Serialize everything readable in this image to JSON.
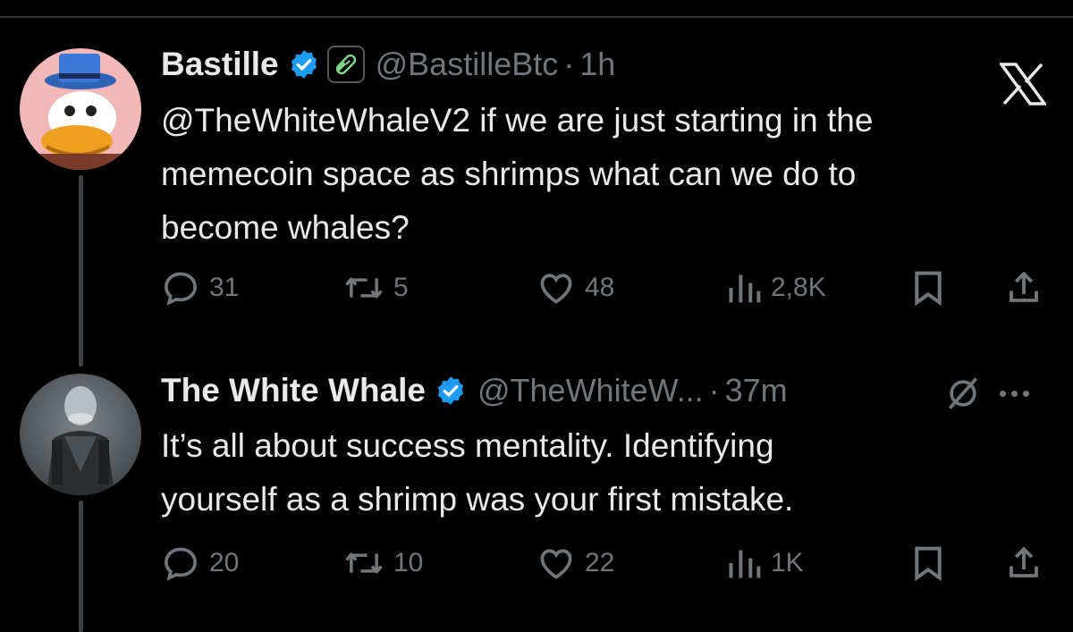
{
  "tweets": [
    {
      "name": "Bastille",
      "handle": "@BastilleBtc",
      "separator": "·",
      "time": "1h",
      "text": "@TheWhiteWhaleV2 if we are just starting in the\nmemecoin space as shrimps what can we do to\nbecome whales?",
      "replies": "31",
      "reposts": "5",
      "likes": "48",
      "views": "2,8K"
    },
    {
      "name": "The White Whale",
      "handle": "@TheWhiteW...",
      "separator": "·",
      "time": "37m",
      "text": "It’s all about success mentality. Identifying\nyourself as a shrimp was your first mistake.",
      "replies": "20",
      "reposts": "10",
      "likes": "22",
      "views": "1K"
    }
  ],
  "colors": {
    "background": "#000000",
    "text": "#e7e9ea",
    "muted": "#71767b",
    "verified": "#1d9bf0",
    "pill_badge": "#7fd98a"
  },
  "icons": [
    "verified-badge-icon",
    "pill-badge-icon",
    "x-logo-icon",
    "reply-icon",
    "repost-icon",
    "like-icon",
    "views-icon",
    "bookmark-icon",
    "share-icon",
    "grok-icon",
    "more-icon"
  ]
}
